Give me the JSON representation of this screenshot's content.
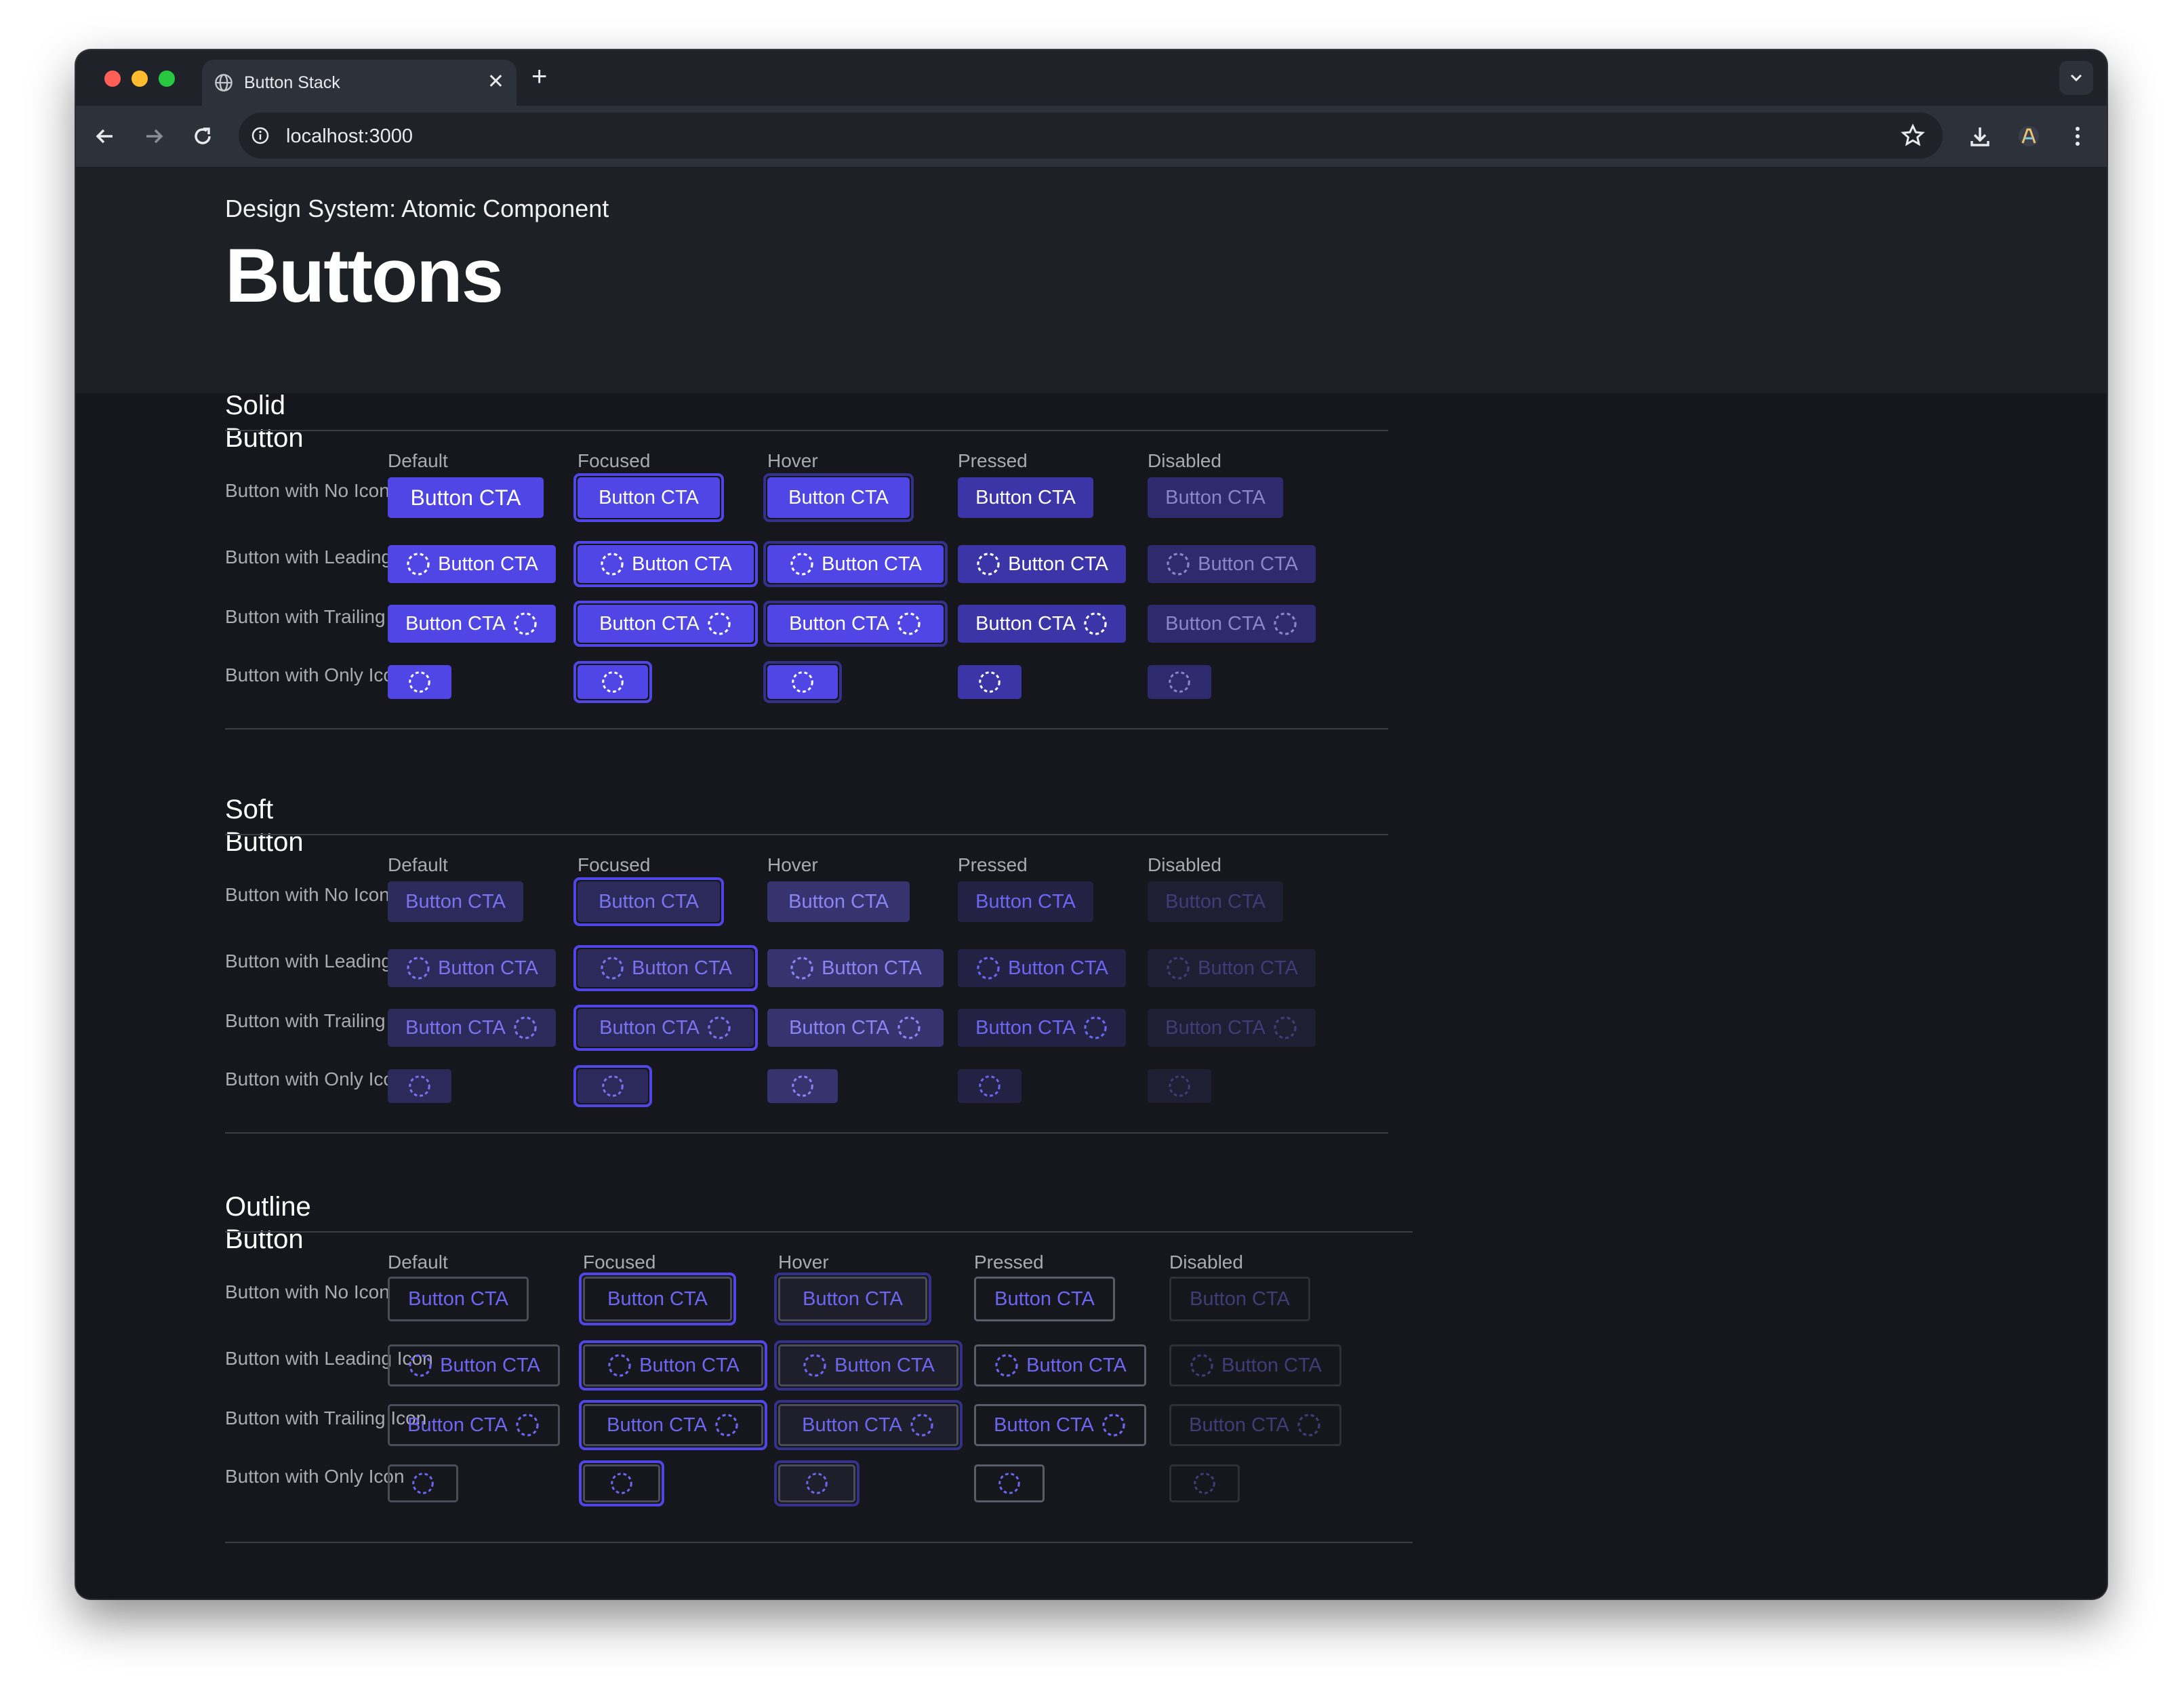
{
  "browser": {
    "tab_title": "Button Stack",
    "tab_close": "✕",
    "new_tab": "+",
    "url": "localhost:3000"
  },
  "header": {
    "eyebrow": "Design System: Atomic Component",
    "title": "Buttons"
  },
  "columns": [
    "Default",
    "Focused",
    "Hover",
    "Pressed",
    "Disabled"
  ],
  "rows": [
    "Button with No Icon",
    "Button with Leading Icon",
    "Button with Trailing Icon",
    "Button with Only Icon"
  ],
  "button_label": "Button CTA",
  "sections": [
    {
      "title": "Solid Button",
      "variant": "solid"
    },
    {
      "title": "Soft Button",
      "variant": "soft"
    },
    {
      "title": "Outline Button",
      "variant": "outline"
    }
  ],
  "colors": {
    "accent": "#4f46e5",
    "accent_text": "#6d66f2",
    "page_bg": "#15171c",
    "header_bg": "#1d2025"
  },
  "icons": {
    "button_icon": "loader-dashed-circle-icon",
    "tab_icon": "globe-icon",
    "back": "arrow-left-icon",
    "forward": "arrow-right-icon",
    "reload": "reload-icon",
    "site_info": "info-icon",
    "bookmark": "star-icon",
    "download": "download-icon",
    "profile": "profile-avatar-icon",
    "menu": "kebab-menu-icon"
  }
}
